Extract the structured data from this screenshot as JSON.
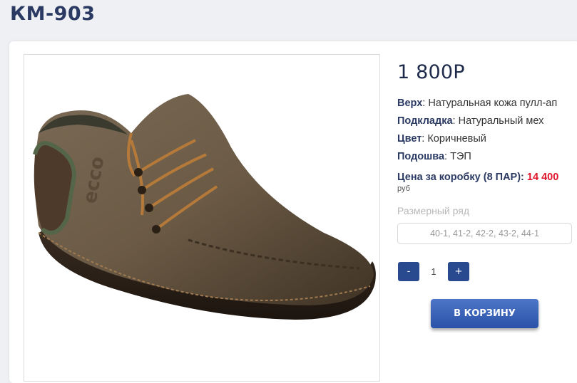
{
  "product": {
    "title": "КМ-903",
    "price": "1 800Р",
    "image_alt": "Brown leather ankle shoe"
  },
  "specs": [
    {
      "label": "Верх",
      "value": "Натуральная кожа пулл-ап"
    },
    {
      "label": "Подкладка",
      "value": "Натуральный мех"
    },
    {
      "label": "Цвет",
      "value": "Коричневый"
    },
    {
      "label": "Подошва",
      "value": "ТЭП"
    }
  ],
  "box_price": {
    "label": "Цена за коробку (8 ПАР):",
    "value": "14 400",
    "currency": "руб"
  },
  "sizes": {
    "label": "Размерный ряд",
    "selected": "40-1, 41-2, 42-2, 43-2, 44-1"
  },
  "quantity": {
    "minus_label": "-",
    "value": "1",
    "plus_label": "+"
  },
  "cart_button": {
    "label": "В КОРЗИНУ"
  },
  "colors": {
    "title": "#2b3a63",
    "accent_blue": "#2a4a90",
    "price_red": "#e0162b",
    "background": "#eef0f3"
  }
}
